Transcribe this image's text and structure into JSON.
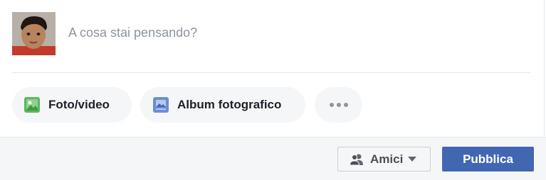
{
  "composer": {
    "prompt": "A cosa stai pensando?"
  },
  "actions": {
    "photo_video": {
      "label": "Foto/video",
      "icon": "photo-icon"
    },
    "album": {
      "label": "Album fotografico",
      "icon": "album-icon"
    },
    "more": {
      "icon": "more-dots-icon"
    }
  },
  "footer": {
    "audience": {
      "label": "Amici",
      "icon": "friends-icon"
    },
    "publish_label": "Pubblica"
  },
  "colors": {
    "publish_button": "#4267b2",
    "photo_icon": "#5cb85c",
    "album_icon": "#6b8fd6",
    "pill_bg": "#f5f6f7",
    "footer_bg": "#f5f6f7"
  }
}
